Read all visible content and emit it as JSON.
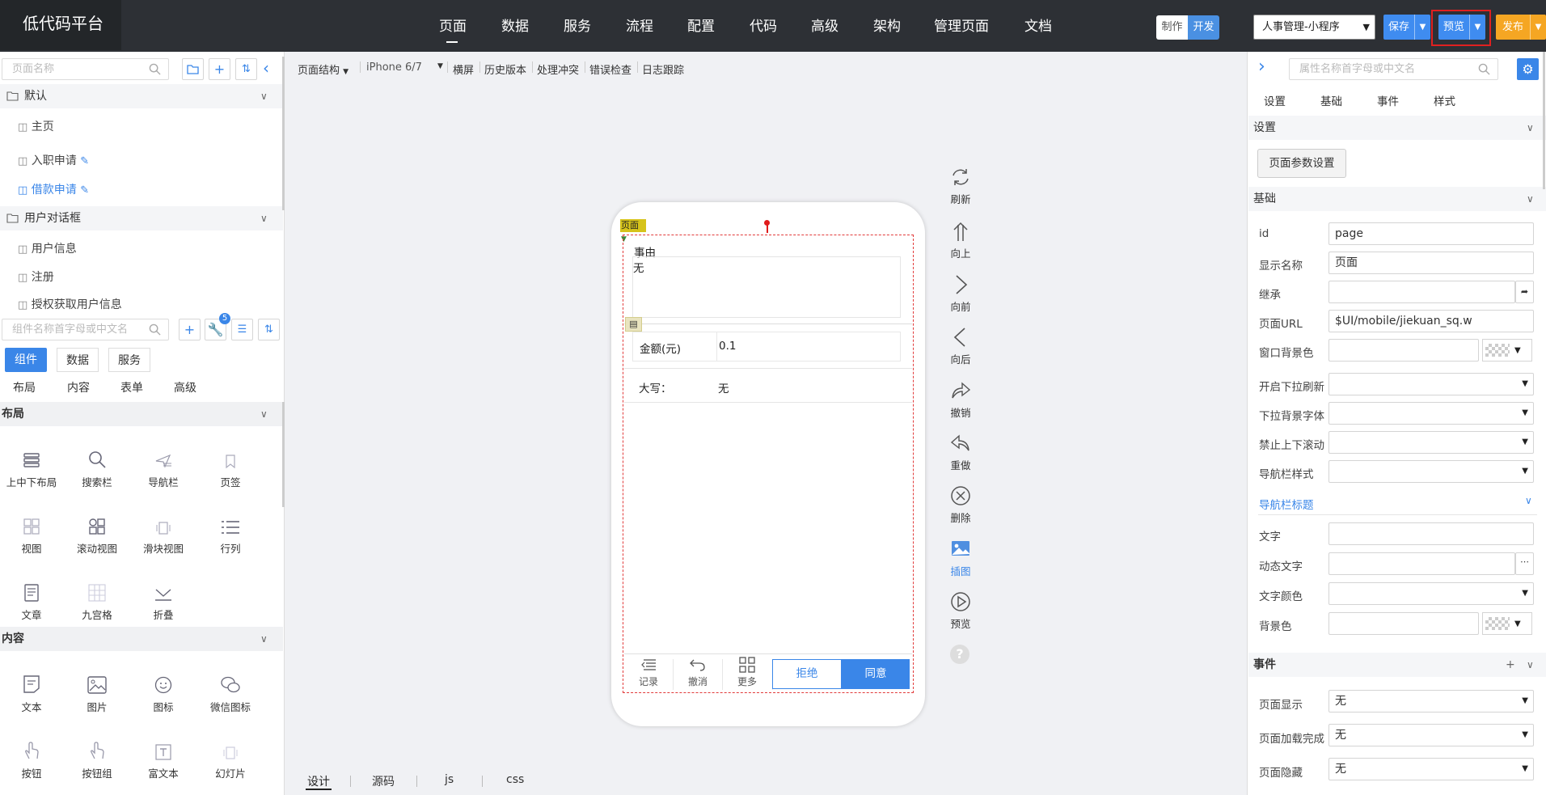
{
  "app": {
    "logo": "低代码平台"
  },
  "topnav": [
    "页面",
    "数据",
    "服务",
    "流程",
    "配置",
    "代码",
    "高级",
    "架构",
    "管理页面",
    "文档"
  ],
  "mode": {
    "make": "制作",
    "dev": "开发"
  },
  "app_selector": "人事管理-小程序",
  "actions": {
    "save": "保存",
    "preview": "预览",
    "publish": "发布"
  },
  "left": {
    "page_search_placeholder": "页面名称",
    "groups": [
      {
        "label": "默认"
      },
      {
        "label": "用户对话框"
      }
    ],
    "default_pages": [
      "主页",
      "入职申请",
      "借款申请"
    ],
    "dialog_pages": [
      "用户信息",
      "注册",
      "授权获取用户信息"
    ],
    "comp_search_placeholder": "组件名称首字母或中文名",
    "badge": "5",
    "tabs": [
      "组件",
      "数据",
      "服务"
    ],
    "subtabs": [
      "布局",
      "内容",
      "表单",
      "高级"
    ],
    "sections": {
      "layout": "布局",
      "content": "内容"
    },
    "layout_items": [
      "上中下布局",
      "搜索栏",
      "导航栏",
      "页签",
      "视图",
      "滚动视图",
      "滑块视图",
      "行列",
      "文章",
      "九宫格",
      "折叠"
    ],
    "content_items": [
      "文本",
      "图片",
      "图标",
      "微信图标",
      "按钮",
      "按钮组",
      "富文本",
      "幻灯片"
    ]
  },
  "toolbar": {
    "structure": "页面结构",
    "device": "iPhone 6/7",
    "items": [
      "横屏",
      "历史版本",
      "处理冲突",
      "错误检查",
      "日志跟踪"
    ]
  },
  "phone": {
    "page_tag": "页面",
    "reason_label": "事由",
    "reason_value": "无",
    "amount_label": "金额(元)",
    "amount_value": "0.1",
    "upper_label": "大写：",
    "upper_value": "无",
    "bottom_icons": [
      "记录",
      "撤消",
      "更多"
    ],
    "reject": "拒绝",
    "agree": "同意"
  },
  "right_tools": [
    "刷新",
    "向上",
    "向前",
    "向后",
    "撤销",
    "重做",
    "删除",
    "插图",
    "预览"
  ],
  "bottom_tabs": [
    "设计",
    "源码",
    "js",
    "css"
  ],
  "right": {
    "search_placeholder": "属性名称首字母或中文名",
    "tabs": [
      "设置",
      "基础",
      "事件",
      "样式"
    ],
    "settings_header": "设置",
    "page_params_button": "页面参数设置",
    "basic_header": "基础",
    "fields": {
      "id": {
        "label": "id",
        "value": "page"
      },
      "display_name": {
        "label": "显示名称",
        "value": "页面"
      },
      "inherit": {
        "label": "继承",
        "value": ""
      },
      "page_url": {
        "label": "页面URL",
        "value": "$UI/mobile/jiekuan_sq.w"
      },
      "window_bg": {
        "label": "窗口背景色"
      },
      "pull_refresh": {
        "label": "开启下拉刷新"
      },
      "pull_bg_font": {
        "label": "下拉背景字体"
      },
      "no_scroll": {
        "label": "禁止上下滚动"
      },
      "nav_style": {
        "label": "导航栏样式"
      }
    },
    "nav_title_header": "导航栏标题",
    "nav_fields": {
      "text": "文字",
      "dynamic_text": "动态文字",
      "text_color": "文字颜色",
      "bg_color": "背景色"
    },
    "events_header": "事件",
    "events": [
      {
        "label": "页面显示",
        "value": "无"
      },
      {
        "label": "页面加载完成",
        "value": "无"
      },
      {
        "label": "页面隐藏",
        "value": "无"
      }
    ]
  },
  "colors": {
    "topbar": "#2d3035",
    "accent": "#3a86e8",
    "preview": "#3f8cf0",
    "publish": "#f5a623",
    "dev": "#4a90e2"
  }
}
